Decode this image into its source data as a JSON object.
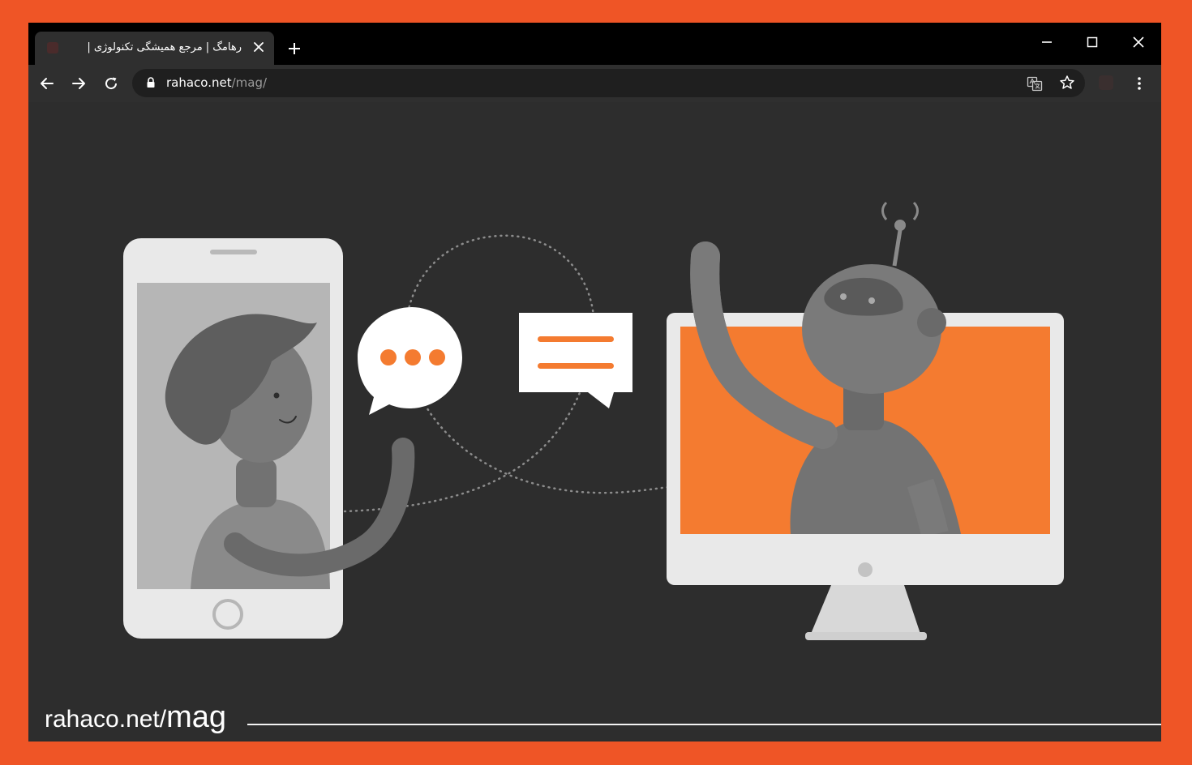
{
  "colors": {
    "frame_orange": "#ef5526",
    "illustration_orange": "#f47b30",
    "dark_background": "#2d2d2d"
  },
  "browser": {
    "tab": {
      "title": "رهامگ | مرجع همیشگی تکنولوژی |",
      "favicon": "rahaco-favicon-icon",
      "close_icon": "close-icon"
    },
    "new_tab_icon": "plus-icon",
    "window_controls": [
      "minimize-icon",
      "maximize-icon",
      "close-icon"
    ],
    "toolbar": {
      "back_icon": "arrow-left-icon",
      "forward_icon": "arrow-right-icon",
      "reload_icon": "reload-icon",
      "lock_icon": "lock-icon",
      "url_host": "rahaco.net",
      "url_path": "/mag/",
      "translate_icon": "translate-icon",
      "bookmark_icon": "star-icon",
      "extension_icon": "extension-icon",
      "menu_icon": "kebab-menu-icon"
    }
  },
  "content": {
    "footer_site": "rahaco.net/",
    "footer_mag": "mag"
  }
}
